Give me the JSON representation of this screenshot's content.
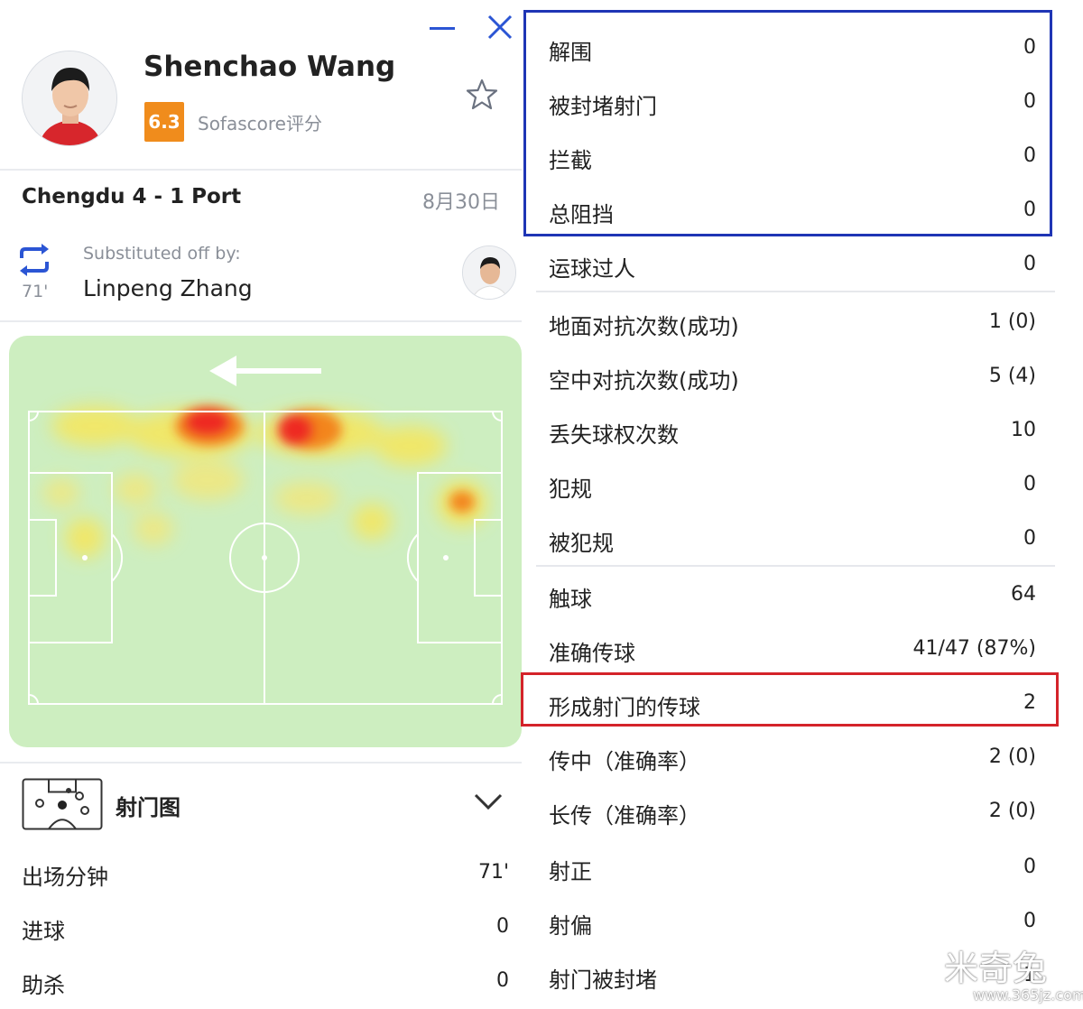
{
  "window": {
    "minimize_icon": "minimize-icon",
    "close_icon": "close-icon"
  },
  "player": {
    "name": "Shenchao Wang",
    "rating": "6.3",
    "rating_label": "Sofascore评分",
    "rating_color": "#f08c1c",
    "favorite_icon": "star-icon"
  },
  "match": {
    "score": "Chengdu 4 - 1 Port",
    "date": "8月30日"
  },
  "substitution": {
    "minute": "71'",
    "caption": "Substituted off by:",
    "player": "Linpeng Zhang",
    "icon": "substitution-icon"
  },
  "heatmap": {
    "direction_icon": "arrow-left-icon",
    "pitch_color": "#cdeec0",
    "line_color": "#ffffff"
  },
  "shotmap": {
    "label": "射门图",
    "icon": "shotmap-icon",
    "chevron": "chevron-down-icon"
  },
  "left_stats": [
    {
      "label": "出场分钟",
      "value": "71'"
    },
    {
      "label": "进球",
      "value": "0"
    },
    {
      "label": "助杀",
      "value": "0"
    }
  ],
  "right_stats": [
    {
      "label": "解围",
      "value": "0"
    },
    {
      "label": "被封堵射门",
      "value": "0"
    },
    {
      "label": "拦截",
      "value": "0"
    },
    {
      "label": "总阻挡",
      "value": "0"
    },
    {
      "label": "运球过人",
      "value": "0"
    },
    {
      "label": "地面对抗次数(成功)",
      "value": "1 (0)"
    },
    {
      "label": "空中对抗次数(成功)",
      "value": "5 (4)"
    },
    {
      "label": "丢失球权次数",
      "value": "10"
    },
    {
      "label": "犯规",
      "value": "0"
    },
    {
      "label": "被犯规",
      "value": "0"
    },
    {
      "label": "触球",
      "value": "64"
    },
    {
      "label": "准确传球",
      "value": "41/47 (87%)"
    },
    {
      "label": "形成射门的传球",
      "value": "2"
    },
    {
      "label": "传中（准确率）",
      "value": "2 (0)"
    },
    {
      "label": "长传（准确率）",
      "value": "2 (0)"
    },
    {
      "label": "射正",
      "value": "0"
    },
    {
      "label": "射偏",
      "value": "0"
    },
    {
      "label": "射门被封堵",
      "value": "1"
    }
  ],
  "highlight_colors": {
    "blue": "#1f35b5",
    "red": "#d4232a"
  },
  "watermark": {
    "text": "米奇兔",
    "url": "www.365jz.com"
  }
}
